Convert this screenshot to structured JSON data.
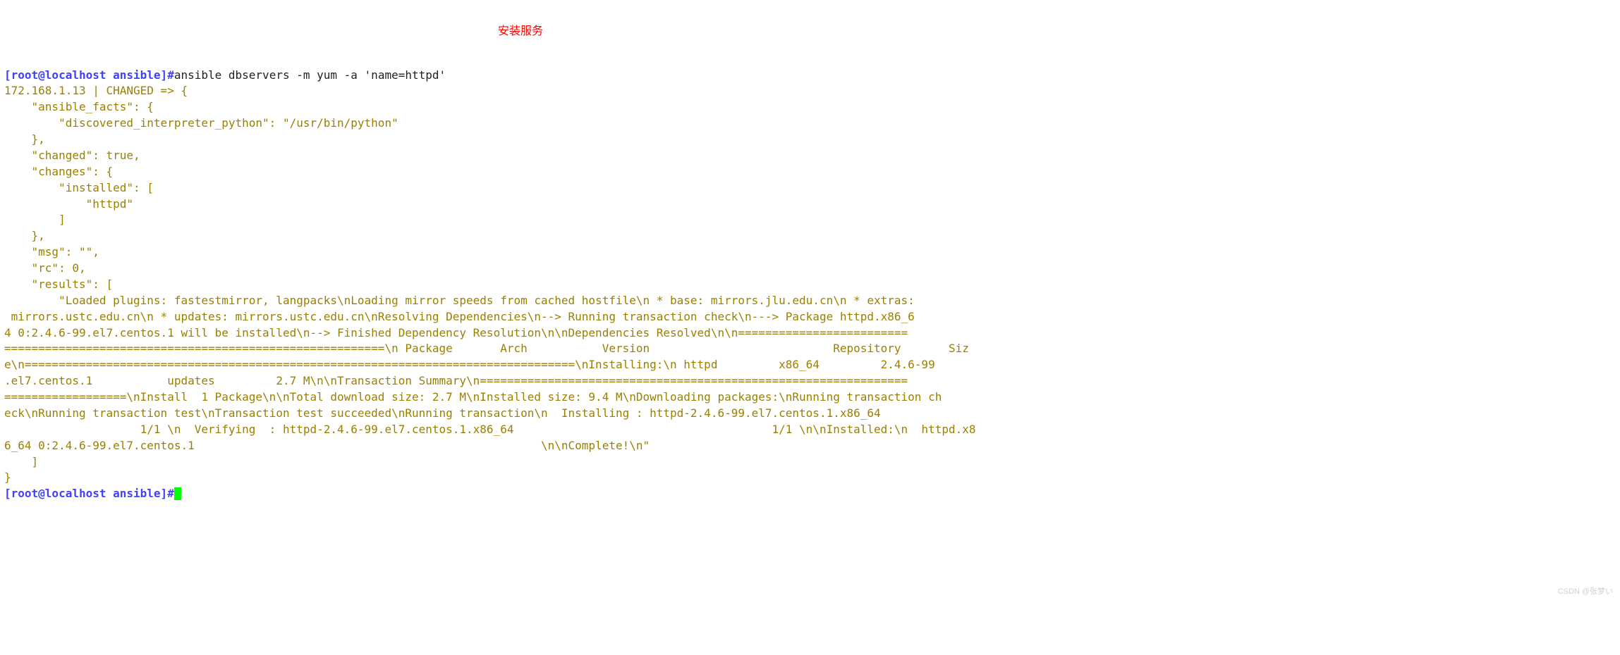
{
  "prompt1": {
    "user_host": "[root@localhost ansible]#",
    "command": "ansible dbservers -m yum -a 'name=httpd'"
  },
  "annotation": "安装服务",
  "output": {
    "host_line": "172.168.1.13 | CHANGED => {",
    "l2": "    \"ansible_facts\": {",
    "l3": "        \"discovered_interpreter_python\": \"/usr/bin/python\"",
    "l4": "    },",
    "l5": "    \"changed\": true,",
    "l6": "    \"changes\": {",
    "l7": "        \"installed\": [",
    "l8": "            \"httpd\"",
    "l9": "        ]",
    "l10": "    },",
    "l11": "    \"msg\": \"\",",
    "l12": "    \"rc\": 0,",
    "l13": "    \"results\": [",
    "l14": "        \"Loaded plugins: fastestmirror, langpacks\\nLoading mirror speeds from cached hostfile\\n * base: mirrors.jlu.edu.cn\\n * extras:",
    "l15": " mirrors.ustc.edu.cn\\n * updates: mirrors.ustc.edu.cn\\nResolving Dependencies\\n--> Running transaction check\\n---> Package httpd.x86_6",
    "l16": "4 0:2.4.6-99.el7.centos.1 will be installed\\n--> Finished Dependency Resolution\\n\\nDependencies Resolved\\n\\n=========================",
    "l17": "========================================================\\n Package       Arch           Version                           Repository       Siz",
    "l18": "e\\n=================================================================================\\nInstalling:\\n httpd         x86_64         2.4.6-99",
    "l19": ".el7.centos.1           updates         2.7 M\\n\\nTransaction Summary\\n===============================================================",
    "l20": "==================\\nInstall  1 Package\\n\\nTotal download size: 2.7 M\\nInstalled size: 9.4 M\\nDownloading packages:\\nRunning transaction ch",
    "l21": "eck\\nRunning transaction test\\nTransaction test succeeded\\nRunning transaction\\n  Installing : httpd-2.4.6-99.el7.centos.1.x86_64     ",
    "l22": "                    1/1 \\n  Verifying  : httpd-2.4.6-99.el7.centos.1.x86_64                                      1/1 \\n\\nInstalled:\\n  httpd.x8",
    "l23": "6_64 0:2.4.6-99.el7.centos.1                                                   \\n\\nComplete!\\n\"",
    "l24": "    ]",
    "l25": "}"
  },
  "prompt2": {
    "user_host": "[root@localhost ansible]#"
  },
  "watermark": "CSDN @张梦い"
}
